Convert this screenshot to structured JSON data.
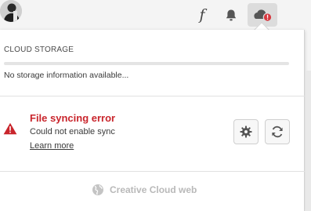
{
  "header": {
    "fonts_icon": "f",
    "icons": [
      "fonts-icon",
      "bell-icon",
      "cloud-alert-icon",
      "user-avatar"
    ]
  },
  "cloud_storage": {
    "title": "CLOUD STORAGE",
    "info": "No storage information available..."
  },
  "sync_error": {
    "title": "File syncing error",
    "message": "Could not enable sync",
    "link": "Learn more"
  },
  "footer": {
    "link": "Creative Cloud web"
  },
  "colors": {
    "error": "#c9252c",
    "muted": "#b9b9b9"
  }
}
